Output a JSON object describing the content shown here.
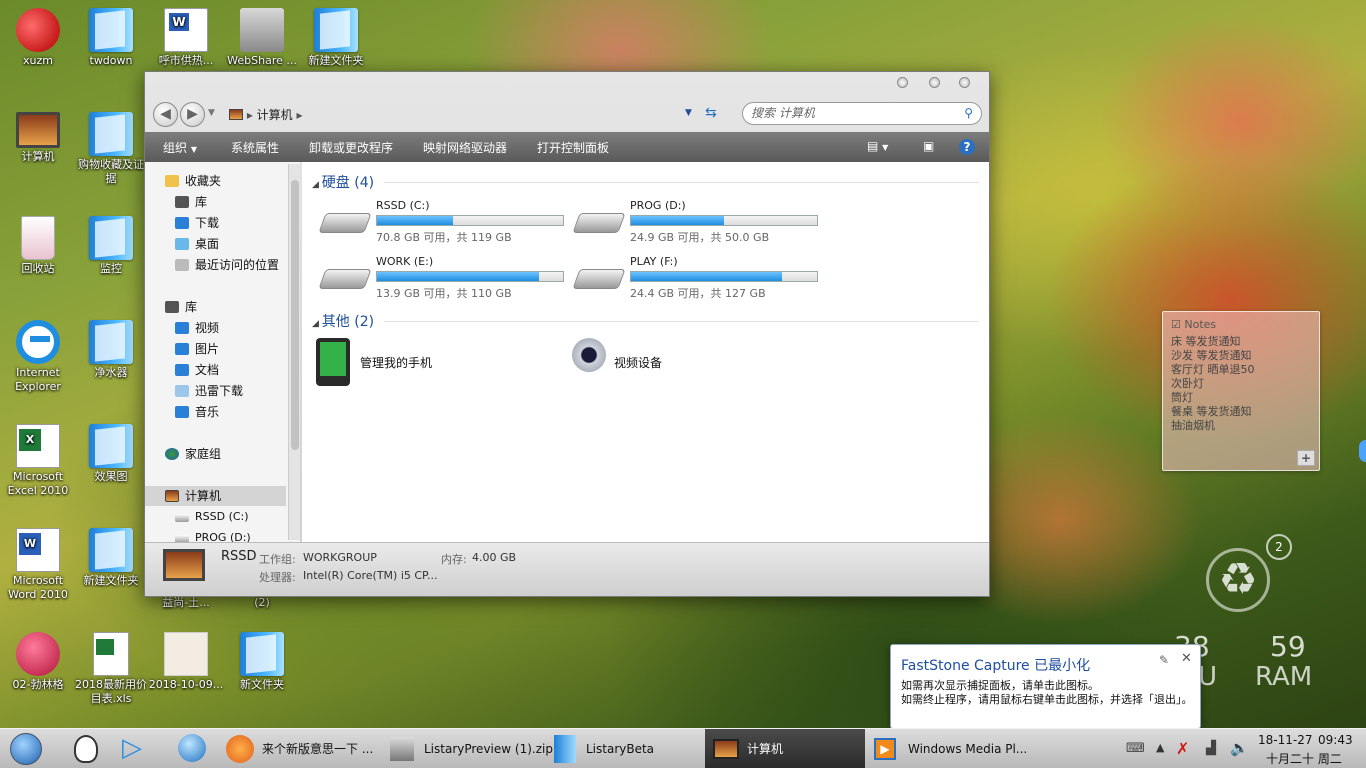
{
  "desktop": {
    "icons": [
      "xuzm",
      "twdown",
      "呼市供热...",
      "WebShare ...",
      "新建文件夹",
      "计算机",
      "购物收藏及证据",
      "回收站",
      "监控",
      "Internet Explorer",
      "净水器",
      "Microsoft Excel 2010",
      "效果图",
      "Microsoft Word 2010",
      "新建文件夹",
      "02-勃林格",
      "2018最新用价目表.xls",
      "2018-10-09...",
      "新文件夹"
    ]
  },
  "explorer": {
    "address": [
      "计算机"
    ],
    "search_placeholder": "搜索 计算机",
    "toolbar": [
      "组织",
      "系统属性",
      "卸载或更改程序",
      "映射网络驱动器",
      "打开控制面板"
    ],
    "sidebar": {
      "favorites": "收藏夹",
      "fav_items": [
        "库",
        "下载",
        "桌面",
        "最近访问的位置"
      ],
      "library": "库",
      "lib_items": [
        "视频",
        "图片",
        "文档",
        "迅雷下载",
        "音乐"
      ],
      "homegroup": "家庭组",
      "computer": "计算机",
      "drives": [
        "RSSD (C:)",
        "PROG (D:)"
      ]
    },
    "hdd_group": "硬盘 (4)",
    "drives": [
      {
        "name": "RSSD (C:)",
        "info": "70.8 GB 可用，共 119 GB",
        "used_fraction": 0.41
      },
      {
        "name": "PROG (D:)",
        "info": "24.9 GB 可用，共 50.0 GB",
        "used_fraction": 0.5
      },
      {
        "name": "WORK (E:)",
        "info": "13.9 GB 可用，共 110 GB",
        "used_fraction": 0.87
      },
      {
        "name": "PLAY (F:)",
        "info": "24.4 GB 可用，共 127 GB",
        "used_fraction": 0.81
      }
    ],
    "other_group": "其他 (2)",
    "others": [
      "管理我的手机",
      "视频设备"
    ],
    "status": {
      "name": "RSSD",
      "workgroup_label": "工作组:",
      "workgroup": "WORKGROUP",
      "memory_label": "内存:",
      "memory": "4.00 GB",
      "cpu_label": "处理器:",
      "cpu": "Intel(R) Core(TM) i5 CP..."
    }
  },
  "notes": {
    "title": "Notes",
    "lines": [
      "床 等发货通知",
      "沙发 等发货通知",
      "客厅灯 晒单退50",
      "次卧灯",
      "筒灯",
      "餐桌 等发货通知",
      "抽油烟机"
    ],
    "add": "+"
  },
  "recycle_badge": "2",
  "clock_widget": {
    "a": "38",
    "b": "59",
    "c": "U",
    "d": "RAM"
  },
  "toast": {
    "title": "FastStone Capture 已最小化",
    "line1": "如需再次显示捕捉面板，请单击此图标。",
    "line2": "如需终止程序，请用鼠标右键单击此图标，并选择「退出」。"
  },
  "overlap": {
    "a": "益尚-土...",
    "b": "(2)"
  },
  "taskbar": {
    "items": [
      "来个新版意思一下 ...",
      "ListaryPreview (1).zip",
      "ListaryBeta",
      "计算机",
      "Windows Media Pl..."
    ],
    "date": "18-11-27",
    "time": "09:43",
    "lunar": "十月二十 周二"
  }
}
